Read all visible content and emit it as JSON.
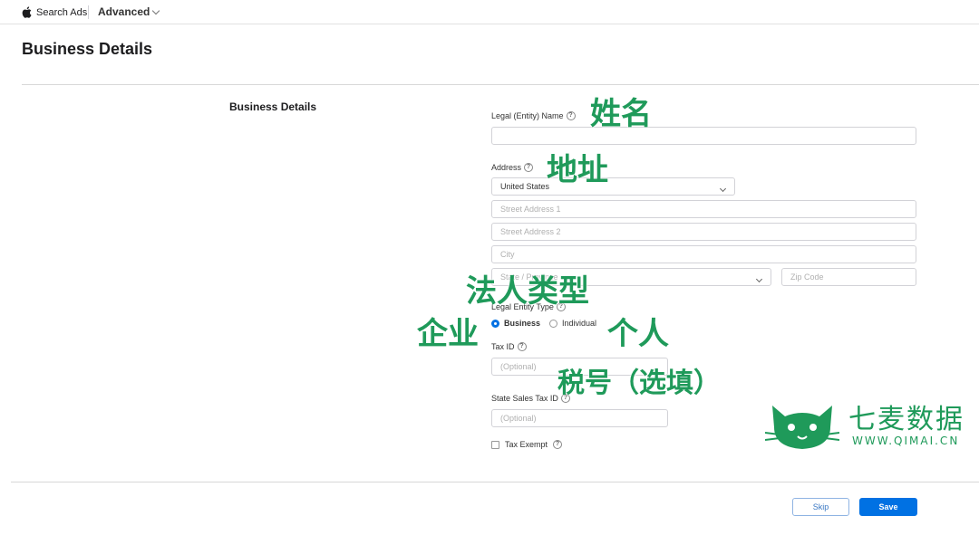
{
  "topbar": {
    "brand": "Search Ads",
    "menu": "Advanced"
  },
  "page": {
    "title": "Business Details",
    "section_title": "Business Details"
  },
  "form": {
    "legal_name_label": "Legal (Entity) Name",
    "legal_name_value": "",
    "address_label": "Address",
    "country_value": "United States",
    "street1_placeholder": "Street Address 1",
    "street2_placeholder": "Street Address 2",
    "city_placeholder": "City",
    "state_placeholder": "State / Province",
    "zip_placeholder": "Zip Code",
    "entity_type_label": "Legal Entity Type",
    "entity_options": [
      "Business",
      "Individual"
    ],
    "entity_selected": "Business",
    "tax_id_label": "Tax ID",
    "tax_id_placeholder": "(Optional)",
    "state_tax_label": "State Sales Tax ID",
    "state_tax_placeholder": "(Optional)",
    "tax_exempt_label": "Tax Exempt",
    "tax_exempt_checked": false
  },
  "actions": {
    "skip": "Skip",
    "save": "Save"
  },
  "annotations": {
    "name": "姓名",
    "address": "地址",
    "entity_type": "法人类型",
    "business": "企业",
    "individual": "个人",
    "tax_id": "税号（选填）"
  },
  "watermark": {
    "name": "七麦数据",
    "url": "WWW.QIMAI.CN"
  },
  "colors": {
    "accent": "#0071e3",
    "annotation": "#1f9a5a"
  }
}
